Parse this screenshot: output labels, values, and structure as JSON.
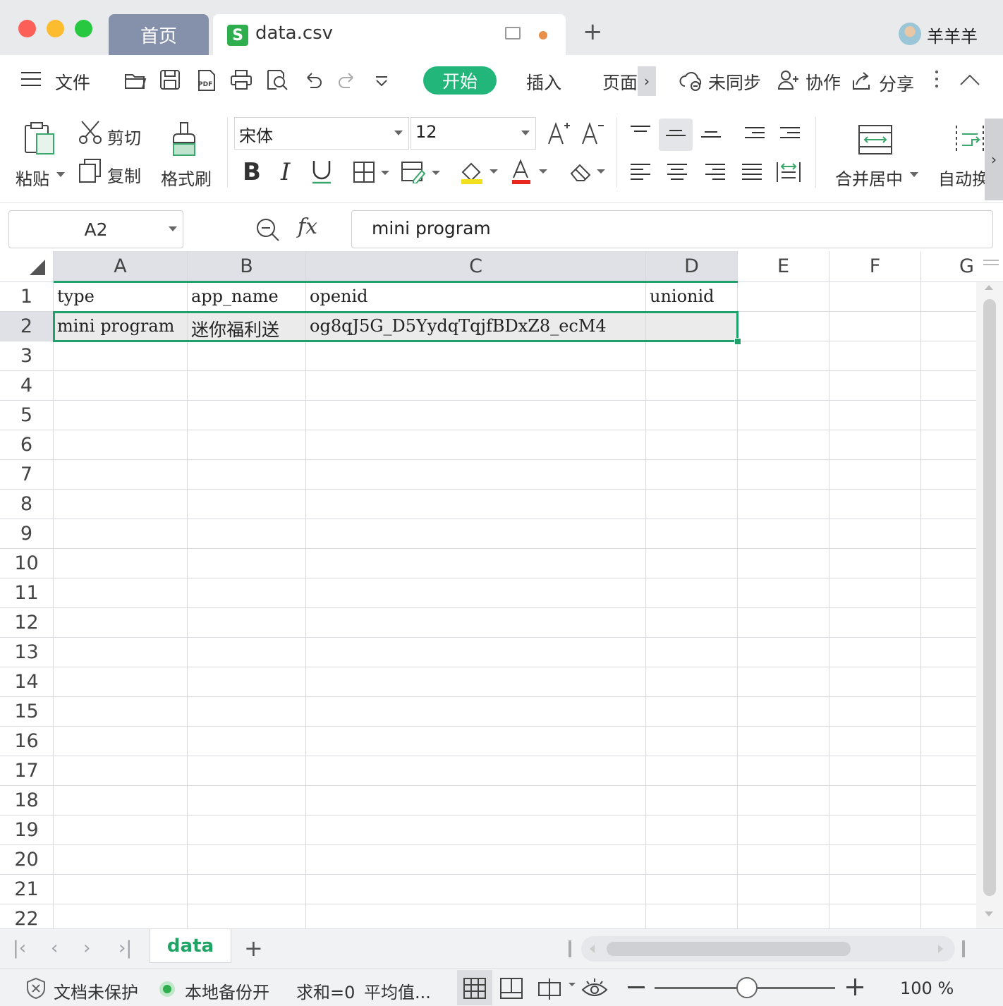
{
  "titlebar": {
    "tabs": [
      {
        "label": "首页"
      },
      {
        "label": "data.csv",
        "icon": "spreadsheet-icon",
        "icon_letter": "S"
      }
    ],
    "new_tab": "+",
    "user_name": "羊羊羊"
  },
  "menubar": {
    "file": "文件",
    "tabs": [
      "开始",
      "插入",
      "页面"
    ],
    "more_arrow": "›",
    "sync": "未同步",
    "collab": "协作",
    "share": "分享"
  },
  "ribbon": {
    "paste": "粘贴",
    "cut": "剪切",
    "copy": "复制",
    "format_painter": "格式刷",
    "font_name": "宋体",
    "font_size": "12",
    "merge_center": "合并居中",
    "auto_wrap": "自动换",
    "colors": {
      "highlight": "#f2e01f",
      "font_color": "#e8281e"
    }
  },
  "formula_bar": {
    "cell_ref": "A2",
    "fx": "fx",
    "value": "mini program"
  },
  "sheet": {
    "columns": [
      "A",
      "B",
      "C",
      "D",
      "E",
      "F",
      "G"
    ],
    "rows": [
      "1",
      "2",
      "3",
      "4",
      "5",
      "6",
      "7",
      "8",
      "9",
      "10",
      "11",
      "12",
      "13",
      "14",
      "15",
      "16",
      "17",
      "18",
      "19",
      "20",
      "21",
      "22"
    ],
    "cells": {
      "A1": "type",
      "B1": "app_name",
      "C1": "openid",
      "D1": "unionid",
      "A2": "mini program",
      "B2": "迷你福利送",
      "C2": "og8qJ5G_D5YydqTqjfBDxZ8_ecM4",
      "D2": ""
    },
    "selected": "A2:D2"
  },
  "sheet_tabs": {
    "nav": [
      "|‹",
      "‹",
      "›",
      "›|"
    ],
    "active": "data",
    "add": "+"
  },
  "status": {
    "protect": "文档未保护",
    "backup": "本地备份开",
    "sum": "求和=0",
    "avg": "平均值...",
    "zoom": "100 %"
  },
  "accent": "#22b67a"
}
